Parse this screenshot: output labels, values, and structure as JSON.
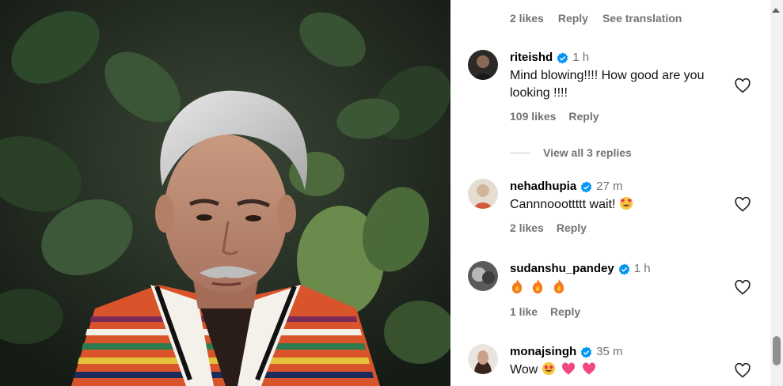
{
  "top_actions": {
    "likes": "2 likes",
    "reply": "Reply",
    "translation": "See translation"
  },
  "comments": [
    {
      "username": "riteishd",
      "time": "1 h",
      "text": "Mind blowing!!!! How good are you looking !!!!",
      "likes": "109 likes",
      "reply": "Reply",
      "avatar": "avatar-riteishd"
    },
    {
      "username": "nehadhupia",
      "time": "27 m",
      "text": "Cannnooottttt wait!",
      "emojis": [
        "heart-eyes-emoji"
      ],
      "likes": "2 likes",
      "reply": "Reply",
      "avatar": "avatar-nehadhupia"
    },
    {
      "username": "sudanshu_pandey",
      "time": "1 h",
      "text": "",
      "emojis": [
        "fire-emoji",
        "fire-emoji",
        "fire-emoji"
      ],
      "likes": "1 like",
      "reply": "Reply",
      "avatar": "avatar-sudanshu"
    },
    {
      "username": "monajsingh",
      "time": "35 m",
      "text": "Wow",
      "emojis": [
        "heart-eyes-emoji",
        "pink-heart-emoji",
        "pink-heart-emoji"
      ],
      "avatar": "avatar-monajsingh"
    }
  ],
  "view_replies": "View all 3 replies",
  "colors": {
    "verified_blue": "#0095f6",
    "muted": "#737373",
    "heart_outline": "#262626"
  },
  "icons": {
    "verified": "verified-badge-icon",
    "like": "heart-outline-icon"
  }
}
